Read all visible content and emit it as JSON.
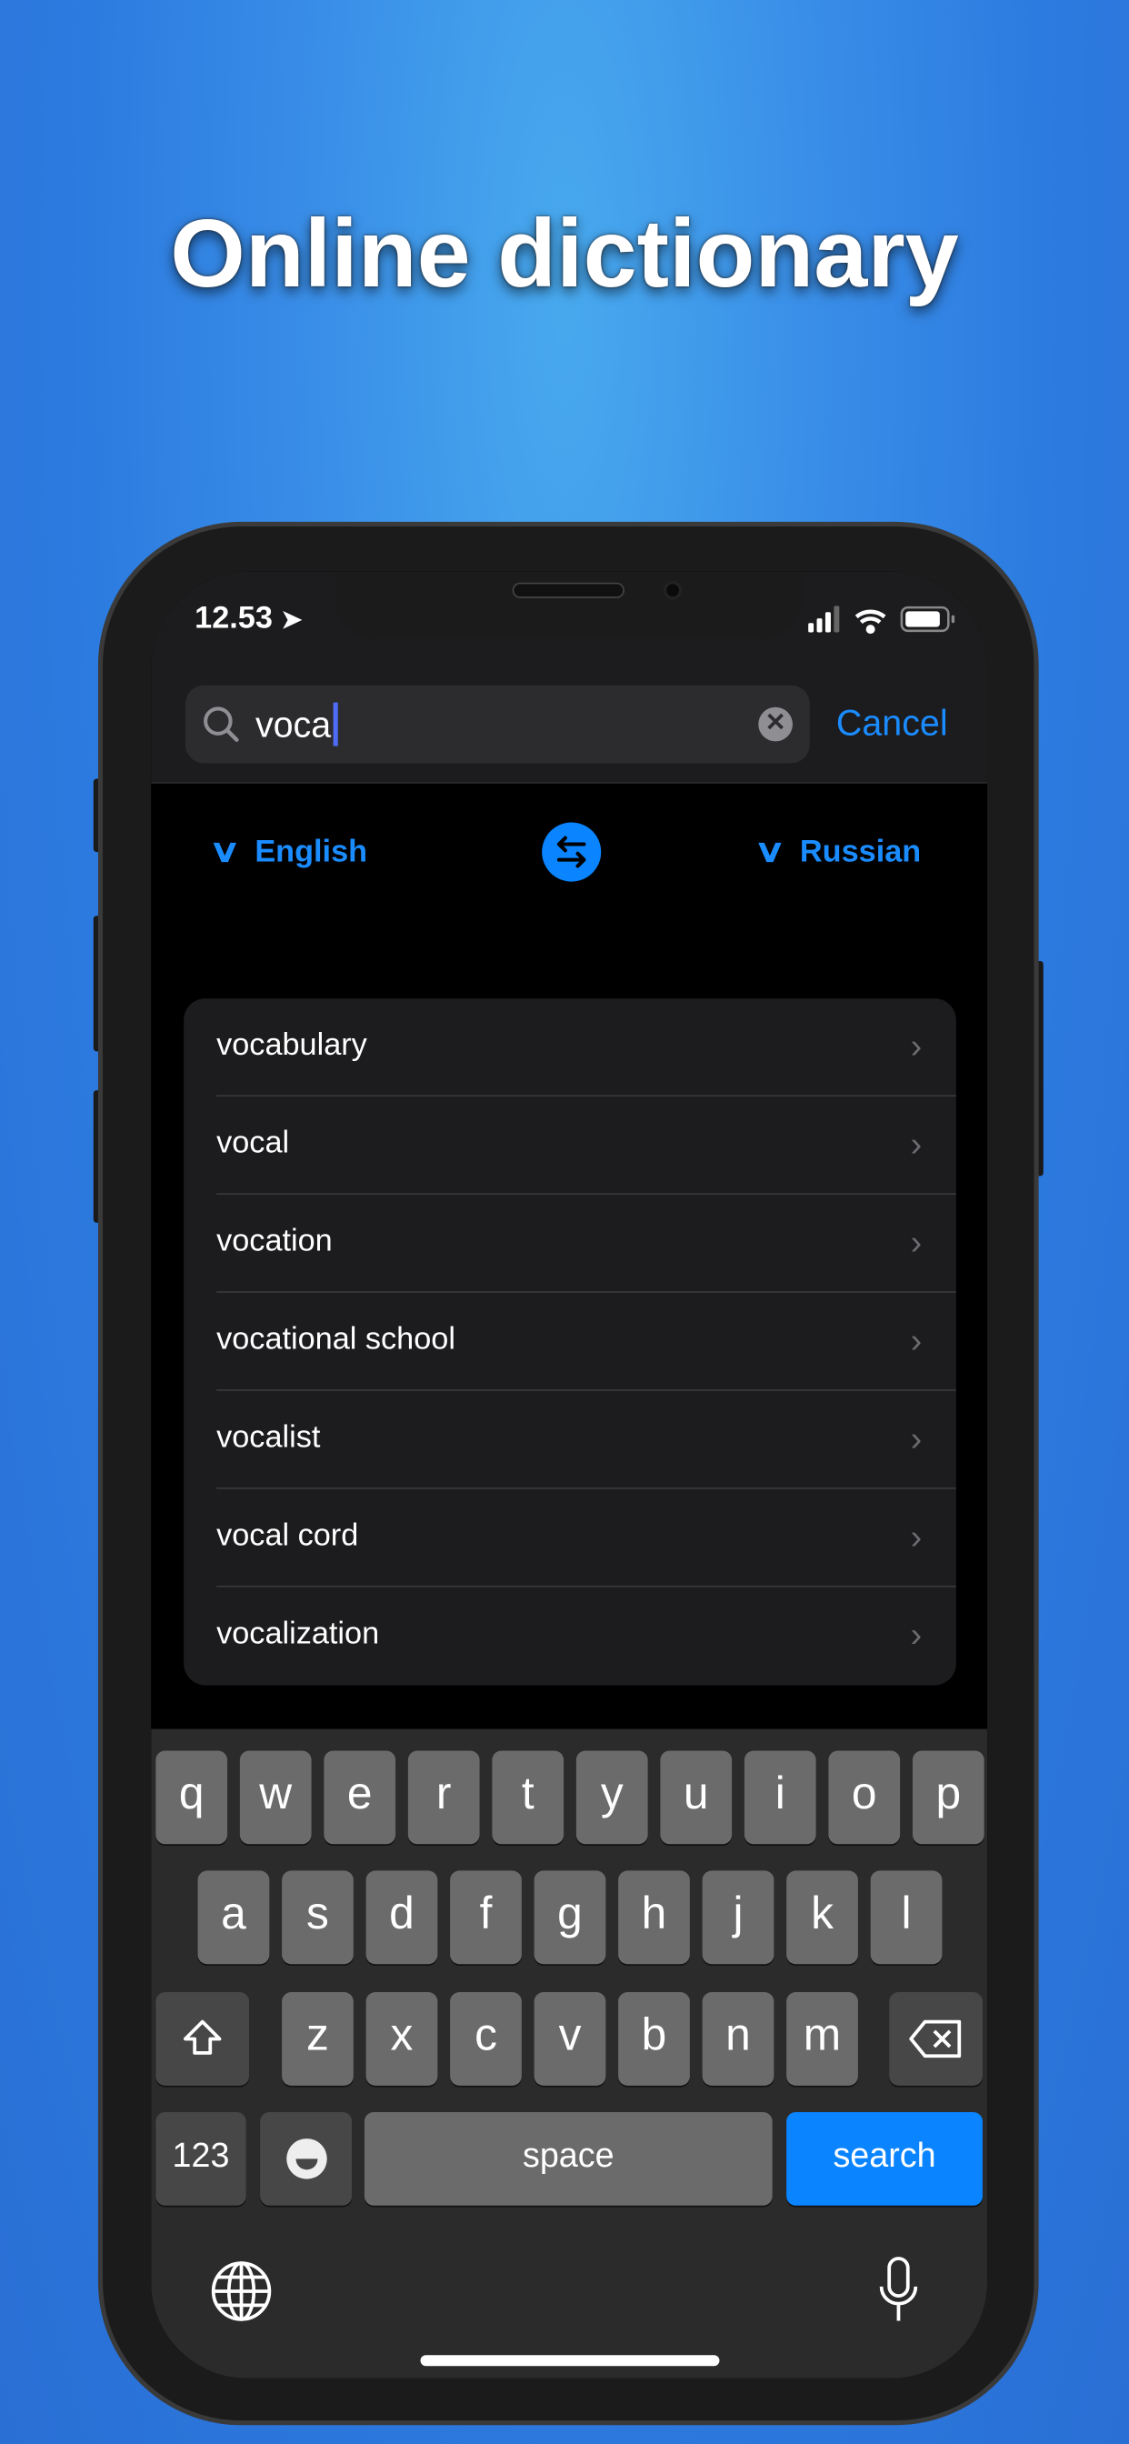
{
  "headline": "Online dictionary",
  "status_bar": {
    "time": "12.53",
    "icons": [
      "location-arrow-icon",
      "cellular-signal-icon",
      "wifi-icon",
      "battery-icon"
    ]
  },
  "search": {
    "value": "voca",
    "clear_icon": "clear-icon",
    "cancel_label": "Cancel"
  },
  "languages": {
    "source": "English",
    "target": "Russian",
    "swap_icon": "swap-arrows-icon"
  },
  "suggestions": [
    "vocabulary",
    "vocal",
    "vocation",
    "vocational school",
    "vocalist",
    "vocal cord",
    "vocalization"
  ],
  "keyboard": {
    "row1": [
      "q",
      "w",
      "e",
      "r",
      "t",
      "y",
      "u",
      "i",
      "o",
      "p"
    ],
    "row2": [
      "a",
      "s",
      "d",
      "f",
      "g",
      "h",
      "j",
      "k",
      "l"
    ],
    "row3": [
      "z",
      "x",
      "c",
      "v",
      "b",
      "n",
      "m"
    ],
    "numbers_label": "123",
    "space_label": "space",
    "search_label": "search"
  },
  "colors": {
    "accent": "#0a84ff",
    "background": "#2c7be0"
  }
}
